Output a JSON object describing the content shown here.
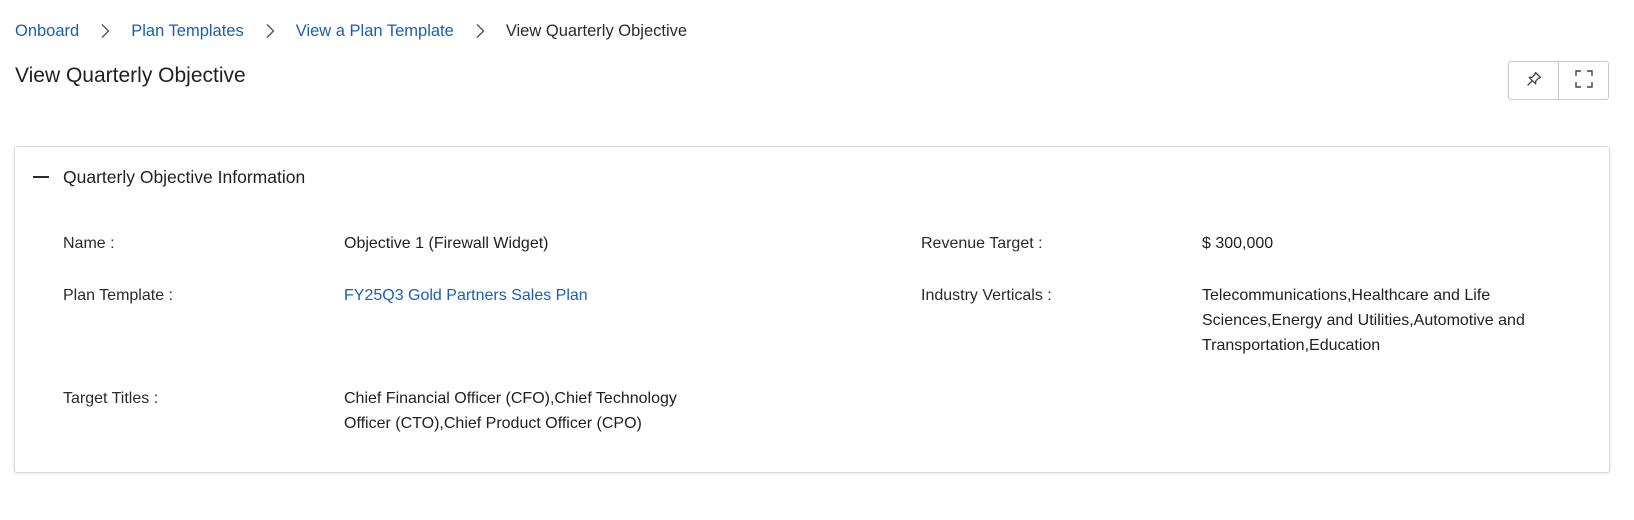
{
  "breadcrumb": {
    "items": [
      {
        "label": "Onboard"
      },
      {
        "label": "Plan Templates"
      },
      {
        "label": "View a Plan Template"
      },
      {
        "label": "View Quarterly Objective"
      }
    ]
  },
  "page": {
    "title": "View Quarterly Objective"
  },
  "toolbar": {
    "pin_icon": "pin-icon",
    "expand_icon": "expand-icon"
  },
  "section": {
    "title": "Quarterly Objective Information",
    "fields": {
      "name": {
        "label": "Name :",
        "value": "Objective 1 (Firewall Widget)"
      },
      "plan_template": {
        "label": "Plan Template :",
        "value": "FY25Q3 Gold Partners Sales Plan"
      },
      "target_titles": {
        "label": "Target Titles :",
        "value_line1": "Chief Financial Officer (CFO),Chief Technology",
        "value_line2": "Officer (CTO),Chief Product Officer (CPO)"
      },
      "revenue_target": {
        "label": "Revenue Target :",
        "value": "$ 300,000"
      },
      "industry_verticals": {
        "label": "Industry Verticals :",
        "value_line1": "Telecommunications,Healthcare and Life",
        "value_line2": "Sciences,Energy and Utilities,Automotive and",
        "value_line3": "Transportation,Education"
      }
    }
  },
  "colors": {
    "link": "#1b5fad",
    "text": "#1f1f1f",
    "border": "#d9d9d9"
  }
}
